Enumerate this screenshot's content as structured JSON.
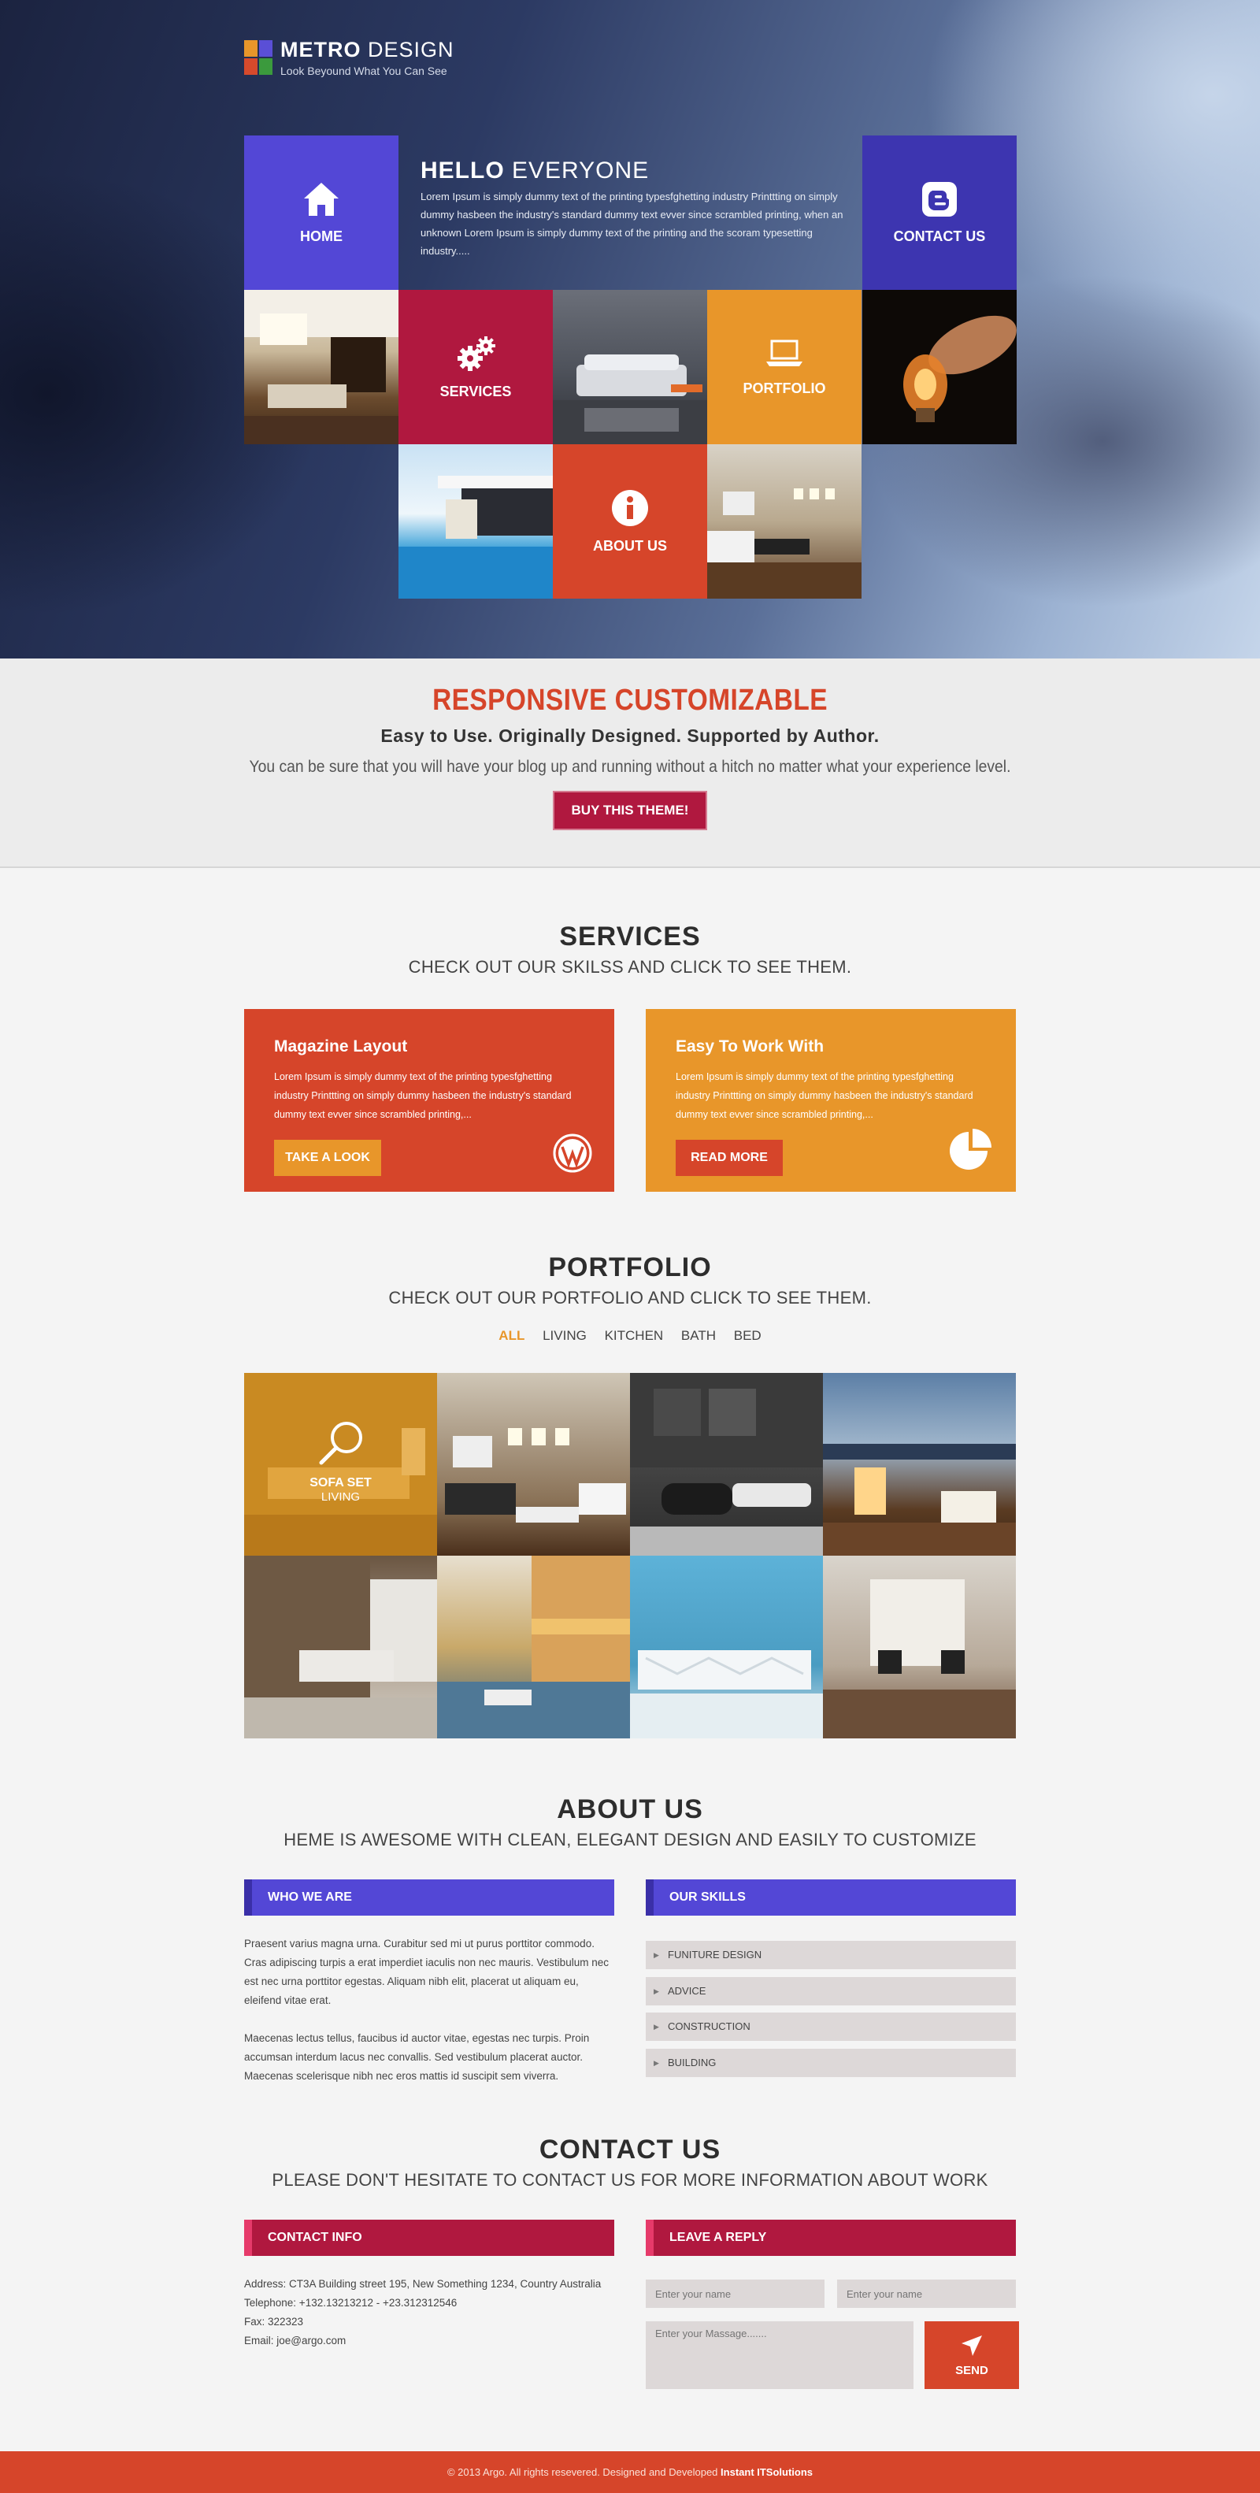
{
  "logo": {
    "brand_bold": "METRO",
    "brand_rest": " DESIGN",
    "tagline": "Look Beyound What You Can See"
  },
  "tiles": {
    "home": "HOME",
    "contact": "CONTACT US",
    "services": "SERVICES",
    "portfolio": "PORTFOLIO",
    "about": "ABOUT US"
  },
  "hello": {
    "title_bold": "HELLO",
    "title_rest": " EVERYONE",
    "text": "Lorem Ipsum is simply dummy text of the printing typesfghetting industry Printtting on simply dummy hasbeen the industry's standard dummy text evver since scrambled printing, when an unknown Lorem Ipsum is simply dummy text of the printing and the scoram typesetting industry....."
  },
  "promo": {
    "title": "RESPONSIVE CUSTOMIZABLE",
    "subtitle": "Easy to Use. Originally Designed.  Supported by Author.",
    "text": "You can be sure that you will have your blog up and running without a hitch no matter what your experience level.",
    "button": "BUY THIS THEME!"
  },
  "services": {
    "title": "SERVICES",
    "subtitle": "CHECK OUT OUR SKILSS AND CLICK TO SEE THEM.",
    "cards": [
      {
        "title": "Magazine  Layout",
        "text": "Lorem Ipsum is simply dummy text of the printing typesfghetting industry Printtting on simply dummy hasbeen the industry's standard dummy text evver since scrambled printing,...",
        "button": "TAKE A LOOK",
        "color": "#d6452a",
        "button_color": "#e8962a",
        "icon": "wordpress-icon"
      },
      {
        "title": "Easy To Work With",
        "text": "Lorem Ipsum is simply dummy text of the printing typesfghetting industry Printtting on simply dummy hasbeen the industry's standard dummy text evver since scrambled printing,...",
        "button": "READ MORE",
        "color": "#e8962a",
        "button_color": "#d6452a",
        "icon": "pie-chart-icon"
      }
    ]
  },
  "portfolio": {
    "title": "PORTFOLIO",
    "subtitle": "CHECK OUT OUR PORTFOLIO AND CLICK TO SEE THEM.",
    "filters": [
      "ALL",
      "LIVING",
      "KITCHEN",
      "BATH",
      "BED"
    ],
    "active_filter": "ALL",
    "overlay_title": "SOFA SET",
    "overlay_sub": "LIVING"
  },
  "about": {
    "title": "ABOUT US",
    "subtitle": "HEME IS AWESOME WITH CLEAN, ELEGANT DESIGN AND EASILY TO CUSTOMIZE",
    "who_title": "WHO WE ARE",
    "who_p1": "Praesent varius magna urna. Curabitur sed mi ut purus porttitor commodo. Cras adipiscing turpis a erat imperdiet iaculis non nec mauris. Vestibulum nec est nec urna porttitor egestas. Aliquam nibh elit, placerat ut aliquam eu, eleifend vitae erat.",
    "who_p2": "Maecenas lectus tellus, faucibus id auctor vitae, egestas nec turpis. Proin accumsan interdum lacus nec convallis. Sed vestibulum placerat auctor.  Maecenas scelerisque nibh nec eros mattis id suscipit sem viverra.",
    "skills_title": "OUR SKILLS",
    "skills": [
      "FUNITURE DESIGN",
      "ADVICE",
      "CONSTRUCTION",
      "BUILDING"
    ]
  },
  "contact": {
    "title": "CONTACT US",
    "subtitle": "PLEASE DON'T HESITATE TO CONTACT US FOR MORE INFORMATION ABOUT WORK",
    "info_title": "CONTACT INFO",
    "address": "Address: CT3A Building street 195, New Something 1234, Country Australia",
    "telephone": "Telephone: +132.13213212 - +23.312312546",
    "fax": "Fax: 322323",
    "email": "Email: joe@argo.com",
    "reply_title": "LEAVE A REPLY",
    "name_placeholder_1": "Enter your name",
    "name_placeholder_2": "Enter your name",
    "message_placeholder": "Enter your Massage.......",
    "send": "SEND"
  },
  "footer": {
    "text": "© 2013 Argo. All rights resevered. Designed and Developed ",
    "brand": "Instant  ITSolutions"
  },
  "colors": {
    "blue": "#5347d6",
    "crimson": "#b0183f",
    "orange": "#e8962a",
    "red": "#d6452a"
  }
}
